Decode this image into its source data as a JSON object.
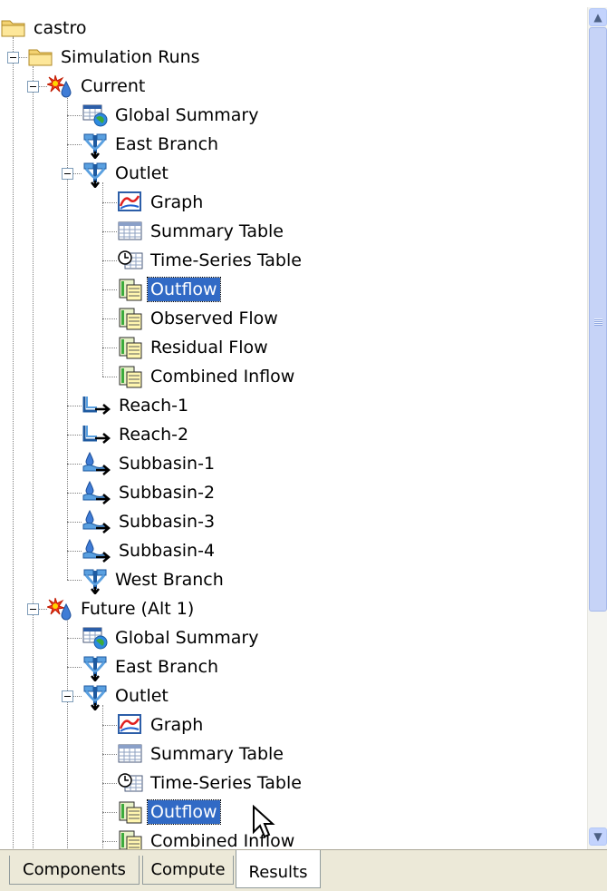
{
  "tree": [
    {
      "label": "castro",
      "icon": "folder-icon",
      "depth": 0,
      "expander": false
    },
    {
      "label": "Simulation Runs",
      "icon": "folder-icon",
      "depth": 1,
      "expander": true
    },
    {
      "label": "Current",
      "icon": "simulation-run-icon",
      "depth": 2,
      "expander": true
    },
    {
      "label": "Global Summary",
      "icon": "global-summary-icon",
      "depth": 3,
      "expander": false
    },
    {
      "label": "East Branch",
      "icon": "junction-icon",
      "depth": 3,
      "expander": false
    },
    {
      "label": "Outlet",
      "icon": "junction-icon",
      "depth": 3,
      "expander": true
    },
    {
      "label": "Graph",
      "icon": "graph-icon",
      "depth": 4,
      "expander": false
    },
    {
      "label": "Summary Table",
      "icon": "summary-table-icon",
      "depth": 4,
      "expander": false
    },
    {
      "label": "Time-Series Table",
      "icon": "time-series-table-icon",
      "depth": 4,
      "expander": false
    },
    {
      "label": "Outflow",
      "icon": "time-series-icon",
      "depth": 4,
      "expander": false,
      "selected": true
    },
    {
      "label": "Observed Flow",
      "icon": "time-series-icon",
      "depth": 4,
      "expander": false
    },
    {
      "label": "Residual Flow",
      "icon": "time-series-icon",
      "depth": 4,
      "expander": false
    },
    {
      "label": "Combined Inflow",
      "icon": "time-series-icon",
      "depth": 4,
      "expander": false
    },
    {
      "label": "Reach-1",
      "icon": "reach-icon",
      "depth": 3,
      "expander": false
    },
    {
      "label": "Reach-2",
      "icon": "reach-icon",
      "depth": 3,
      "expander": false
    },
    {
      "label": "Subbasin-1",
      "icon": "subbasin-icon",
      "depth": 3,
      "expander": false
    },
    {
      "label": "Subbasin-2",
      "icon": "subbasin-icon",
      "depth": 3,
      "expander": false
    },
    {
      "label": "Subbasin-3",
      "icon": "subbasin-icon",
      "depth": 3,
      "expander": false
    },
    {
      "label": "Subbasin-4",
      "icon": "subbasin-icon",
      "depth": 3,
      "expander": false
    },
    {
      "label": "West Branch",
      "icon": "junction-icon",
      "depth": 3,
      "expander": false
    },
    {
      "label": "Future (Alt 1)",
      "icon": "simulation-run-icon",
      "depth": 2,
      "expander": true
    },
    {
      "label": "Global Summary",
      "icon": "global-summary-icon",
      "depth": 3,
      "expander": false
    },
    {
      "label": "East Branch",
      "icon": "junction-icon",
      "depth": 3,
      "expander": false
    },
    {
      "label": "Outlet",
      "icon": "junction-icon",
      "depth": 3,
      "expander": true
    },
    {
      "label": "Graph",
      "icon": "graph-icon",
      "depth": 4,
      "expander": false
    },
    {
      "label": "Summary Table",
      "icon": "summary-table-icon",
      "depth": 4,
      "expander": false
    },
    {
      "label": "Time-Series Table",
      "icon": "time-series-table-icon",
      "depth": 4,
      "expander": false
    },
    {
      "label": "Outflow",
      "icon": "time-series-icon",
      "depth": 4,
      "expander": false,
      "selected": true
    },
    {
      "label": "Combined Inflow",
      "icon": "time-series-icon",
      "depth": 4,
      "expander": false
    }
  ],
  "tabs": [
    {
      "label": "Components",
      "active": false
    },
    {
      "label": "Compute",
      "active": false
    },
    {
      "label": "Results",
      "active": true
    }
  ],
  "scrollbar": {
    "up_icon": "scroll-up-icon",
    "down_icon": "scroll-down-icon"
  },
  "colors": {
    "selection": "#316ac5",
    "tree_line": "#808080",
    "tab_bg": "#ece9d8"
  }
}
